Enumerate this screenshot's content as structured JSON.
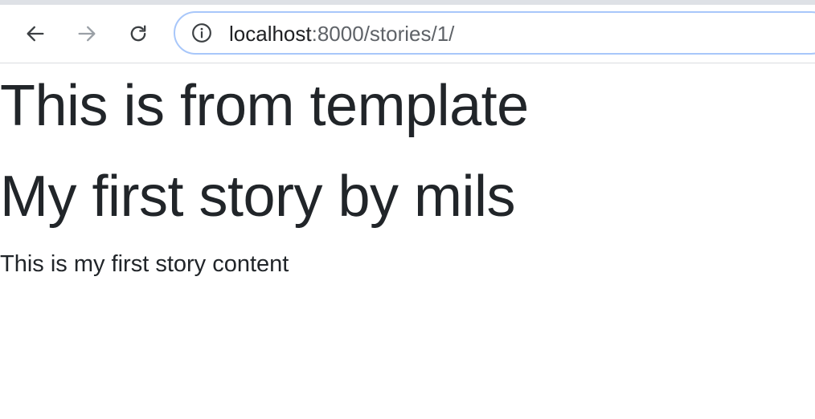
{
  "browser": {
    "url_host": "localhost",
    "url_path": ":8000/stories/1/",
    "icons": {
      "back": "arrow-left-icon",
      "forward": "arrow-right-icon",
      "reload": "reload-icon",
      "site_info": "info-circle-icon"
    }
  },
  "page": {
    "template_heading": "This is from template",
    "story_title": "My first story by mils",
    "story_content": "This is my first story content"
  }
}
